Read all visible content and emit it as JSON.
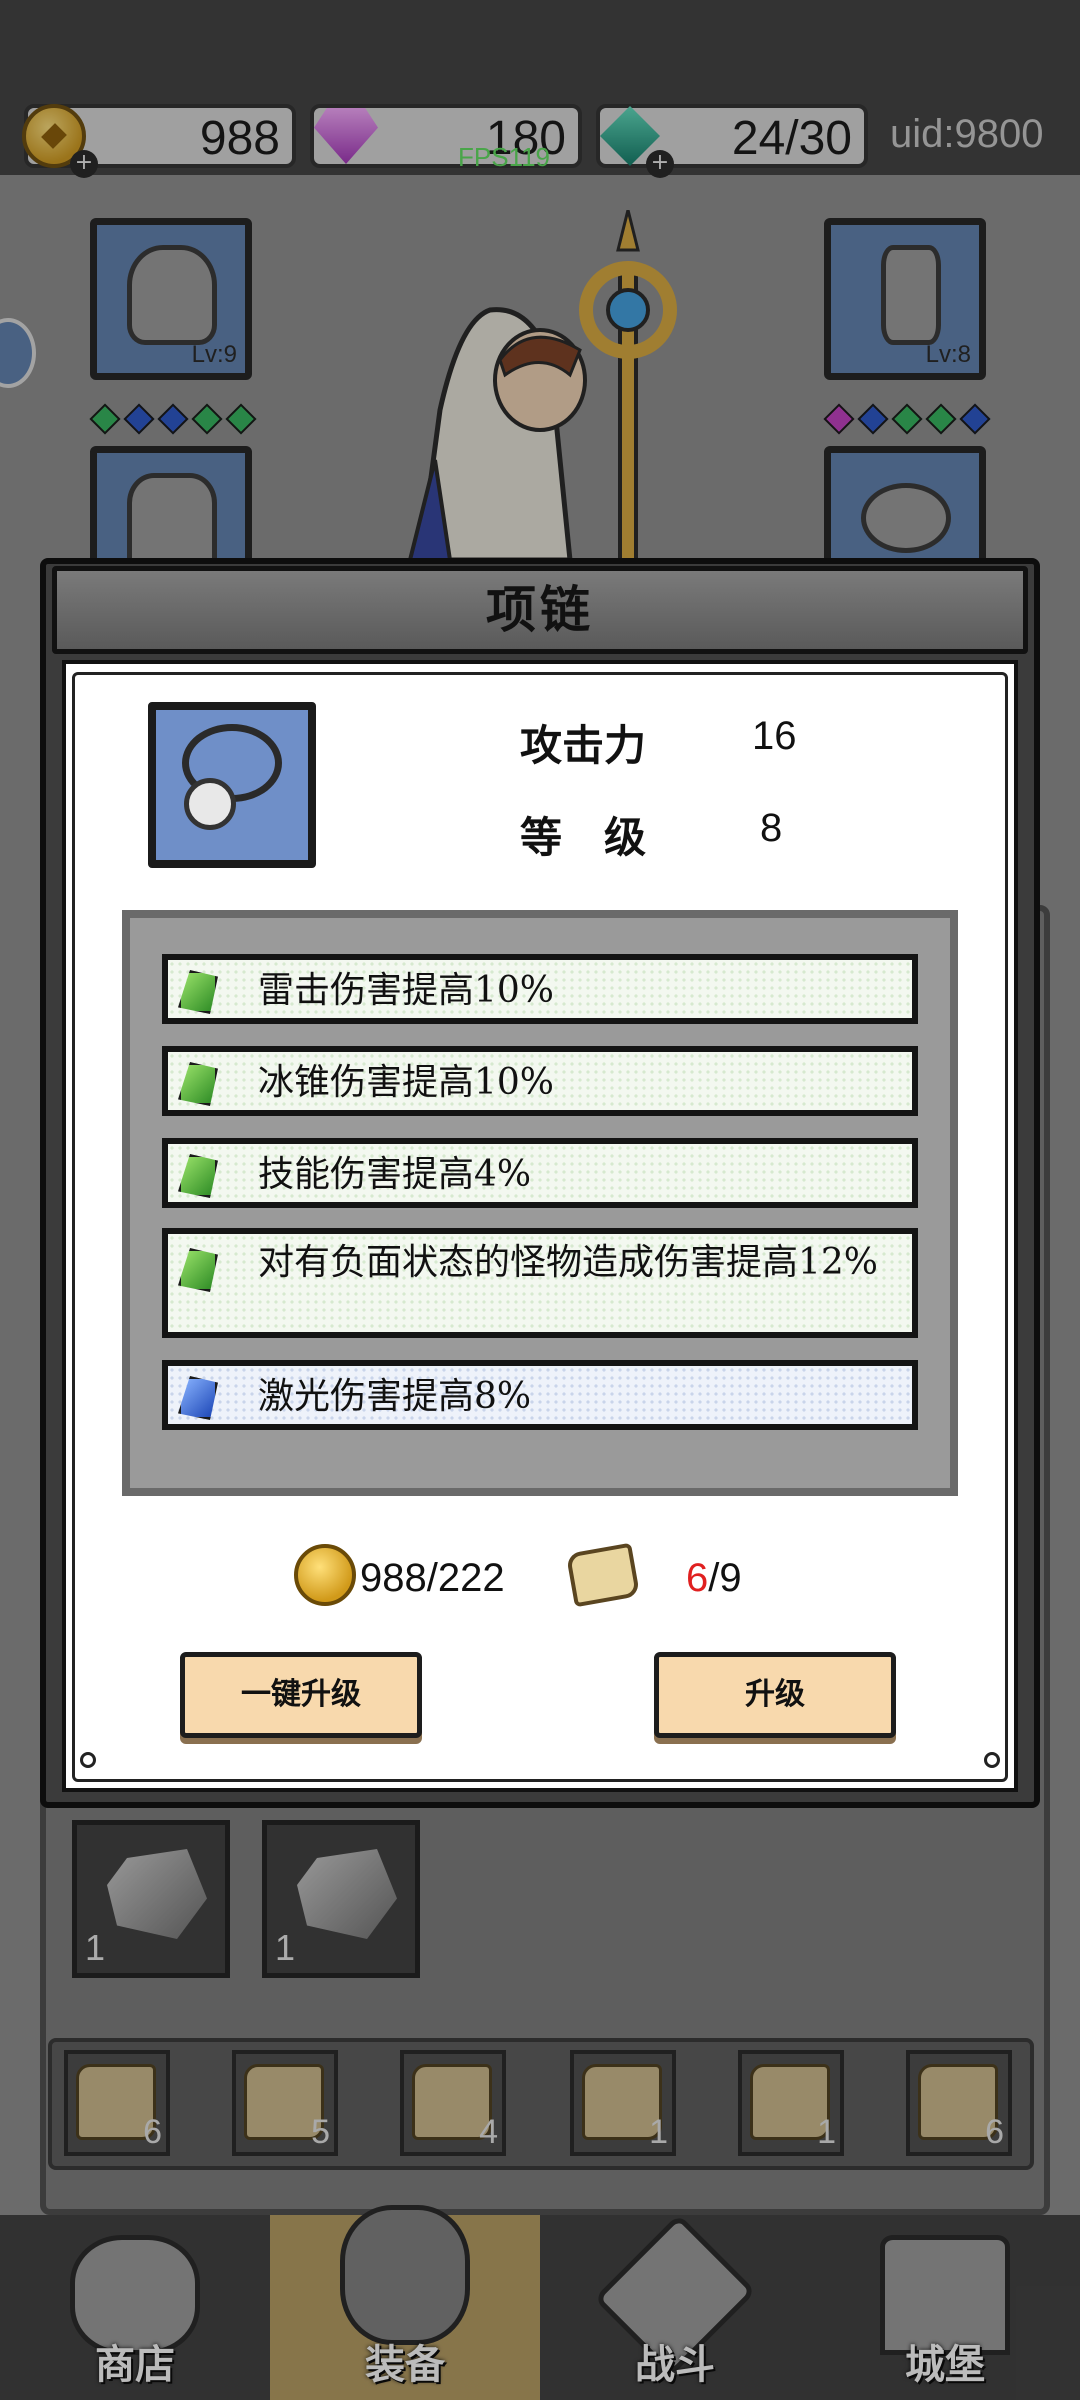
{
  "resources": {
    "gold": "988",
    "gems": "180",
    "energy": "24/30",
    "uid": "uid:9800",
    "fps": "FPS119",
    "plus": "+"
  },
  "equipment_slots": {
    "helmet_level": "Lv:9",
    "weapon_level": "Lv:8"
  },
  "modal": {
    "title": "项链",
    "stats": [
      {
        "label": "攻击力",
        "value": "16"
      },
      {
        "label": "等　级",
        "value": "8"
      }
    ],
    "bonuses": [
      {
        "text": "雷击伤害提高10%",
        "gem": "green"
      },
      {
        "text": "冰锥伤害提高10%",
        "gem": "green"
      },
      {
        "text": "技能伤害提高4%",
        "gem": "green"
      },
      {
        "text": "对有负面状态的怪物造成伤害提高12%",
        "gem": "green"
      },
      {
        "text": "激光伤害提高8%",
        "gem": "blue"
      }
    ],
    "cost_gold": "988/222",
    "scroll_have": "6",
    "scroll_sep_need": "/9",
    "buttons": {
      "upgrade_all": "一键升级",
      "upgrade": "升级"
    }
  },
  "inventory": {
    "items": [
      {
        "count": "1"
      },
      {
        "count": "1"
      }
    ],
    "scrolls": [
      {
        "count": "6"
      },
      {
        "count": "5"
      },
      {
        "count": "4"
      },
      {
        "count": "1"
      },
      {
        "count": "1"
      },
      {
        "count": "6"
      }
    ]
  },
  "nav": {
    "tabs": [
      {
        "label": "商店",
        "icon": "shop-icon"
      },
      {
        "label": "装备",
        "icon": "backpack-icon",
        "active": true
      },
      {
        "label": "战斗",
        "icon": "crossed-swords-icon"
      },
      {
        "label": "城堡",
        "icon": "castle-icon"
      }
    ]
  },
  "colors": {
    "scroll_have_color": "#e02020",
    "active_tab": "#b59b5e",
    "button_bg": "#f8d9ad"
  }
}
